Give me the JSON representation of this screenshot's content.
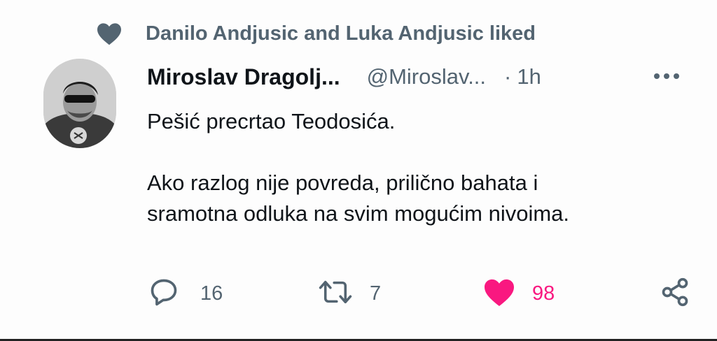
{
  "social_context": {
    "text": "Danilo Andjusic and Luka Andjusic liked",
    "icon": "heart-icon"
  },
  "tweet": {
    "display_name": "Miroslav Dragolj...",
    "handle": "@Miroslav...",
    "separator": "·",
    "time": "1h",
    "text_line1": "Pešić precrtao Teodosića.",
    "text_line2": "Ako razlog nije povreda, prilično bahata i",
    "text_line3": "sramotna odluka na svim mogućim nivoima."
  },
  "actions": {
    "reply_count": "16",
    "retweet_count": "7",
    "like_count": "98"
  },
  "colors": {
    "secondary_text": "#536471",
    "like_pink": "#f91880",
    "primary_text": "#0f1419"
  }
}
